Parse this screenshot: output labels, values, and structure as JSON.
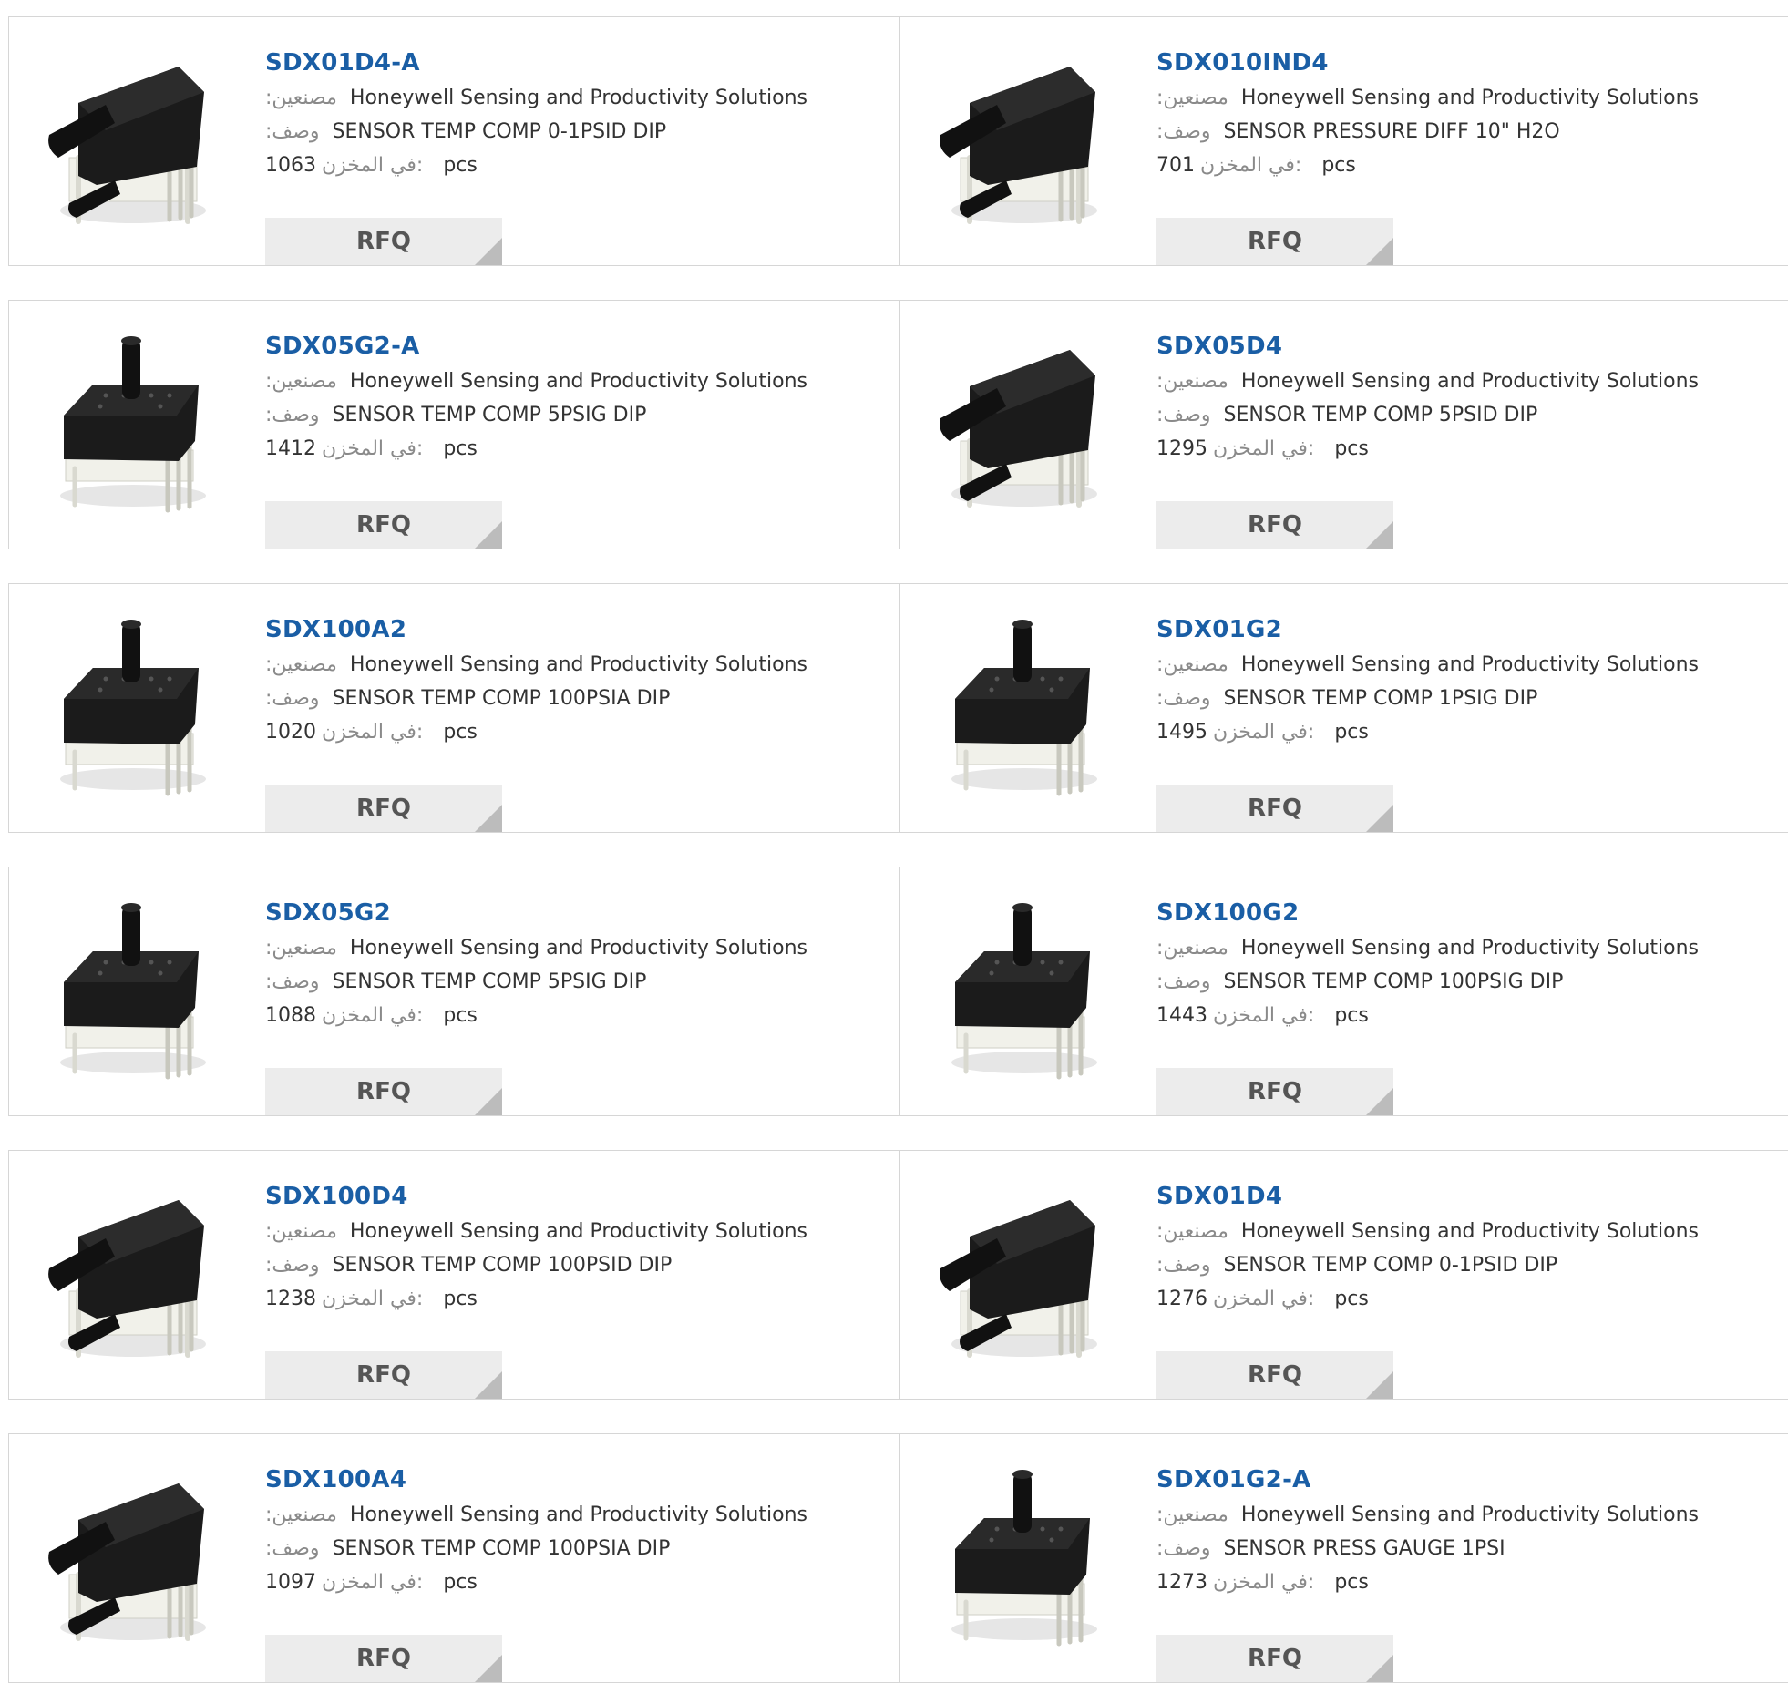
{
  "labels": {
    "manufacturer": ":مصنعين",
    "description": ":وصف",
    "in_stock": "في المخزن:",
    "unit": "pcs",
    "rfq": "RFQ"
  },
  "products": [
    {
      "pn": "SDX01D4-A",
      "mfr": "Honeywell Sensing and Productivity Solutions",
      "desc": "SENSOR TEMP COMP 0-1PSID DIP",
      "stock": "1063",
      "image": "differential-sensor-image"
    },
    {
      "pn": "SDX010IND4",
      "mfr": "Honeywell Sensing and Productivity Solutions",
      "desc": "SENSOR PRESSURE DIFF 10\" H2O",
      "stock": "701",
      "image": "differential-sensor-image"
    },
    {
      "pn": "SDX05G2-A",
      "mfr": "Honeywell Sensing and Productivity Solutions",
      "desc": "SENSOR TEMP COMP 5PSIG DIP",
      "stock": "1412",
      "image": "gauge-sensor-image"
    },
    {
      "pn": "SDX05D4",
      "mfr": "Honeywell Sensing and Productivity Solutions",
      "desc": "SENSOR TEMP COMP 5PSID DIP",
      "stock": "1295",
      "image": "differential-sensor-image"
    },
    {
      "pn": "SDX100A2",
      "mfr": "Honeywell Sensing and Productivity Solutions",
      "desc": "SENSOR TEMP COMP 100PSIA DIP",
      "stock": "1020",
      "image": "gauge-sensor-image"
    },
    {
      "pn": "SDX01G2",
      "mfr": "Honeywell Sensing and Productivity Solutions",
      "desc": "SENSOR TEMP COMP 1PSIG DIP",
      "stock": "1495",
      "image": "gauge-sensor-image"
    },
    {
      "pn": "SDX05G2",
      "mfr": "Honeywell Sensing and Productivity Solutions",
      "desc": "SENSOR TEMP COMP 5PSIG DIP",
      "stock": "1088",
      "image": "gauge-sensor-image"
    },
    {
      "pn": "SDX100G2",
      "mfr": "Honeywell Sensing and Productivity Solutions",
      "desc": "SENSOR TEMP COMP 100PSIG DIP",
      "stock": "1443",
      "image": "gauge-sensor-image"
    },
    {
      "pn": "SDX100D4",
      "mfr": "Honeywell Sensing and Productivity Solutions",
      "desc": "SENSOR TEMP COMP 100PSID DIP",
      "stock": "1238",
      "image": "differential-sensor-image"
    },
    {
      "pn": "SDX01D4",
      "mfr": "Honeywell Sensing and Productivity Solutions",
      "desc": "SENSOR TEMP COMP 0-1PSID DIP",
      "stock": "1276",
      "image": "differential-sensor-image"
    },
    {
      "pn": "SDX100A4",
      "mfr": "Honeywell Sensing and Productivity Solutions",
      "desc": "SENSOR TEMP COMP 100PSIA DIP",
      "stock": "1097",
      "image": "differential-sensor-image"
    },
    {
      "pn": "SDX01G2-A",
      "mfr": "Honeywell Sensing and Productivity Solutions",
      "desc": "SENSOR PRESS GAUGE 1PSI",
      "stock": "1273",
      "image": "gauge-sensor-image"
    }
  ],
  "colors": {
    "link": "#1a5ea5",
    "label": "#8a8a8a",
    "text": "#333333",
    "border": "#d6d6d6",
    "button_bg": "#ececec",
    "button_corner": "#bcbcbc"
  }
}
